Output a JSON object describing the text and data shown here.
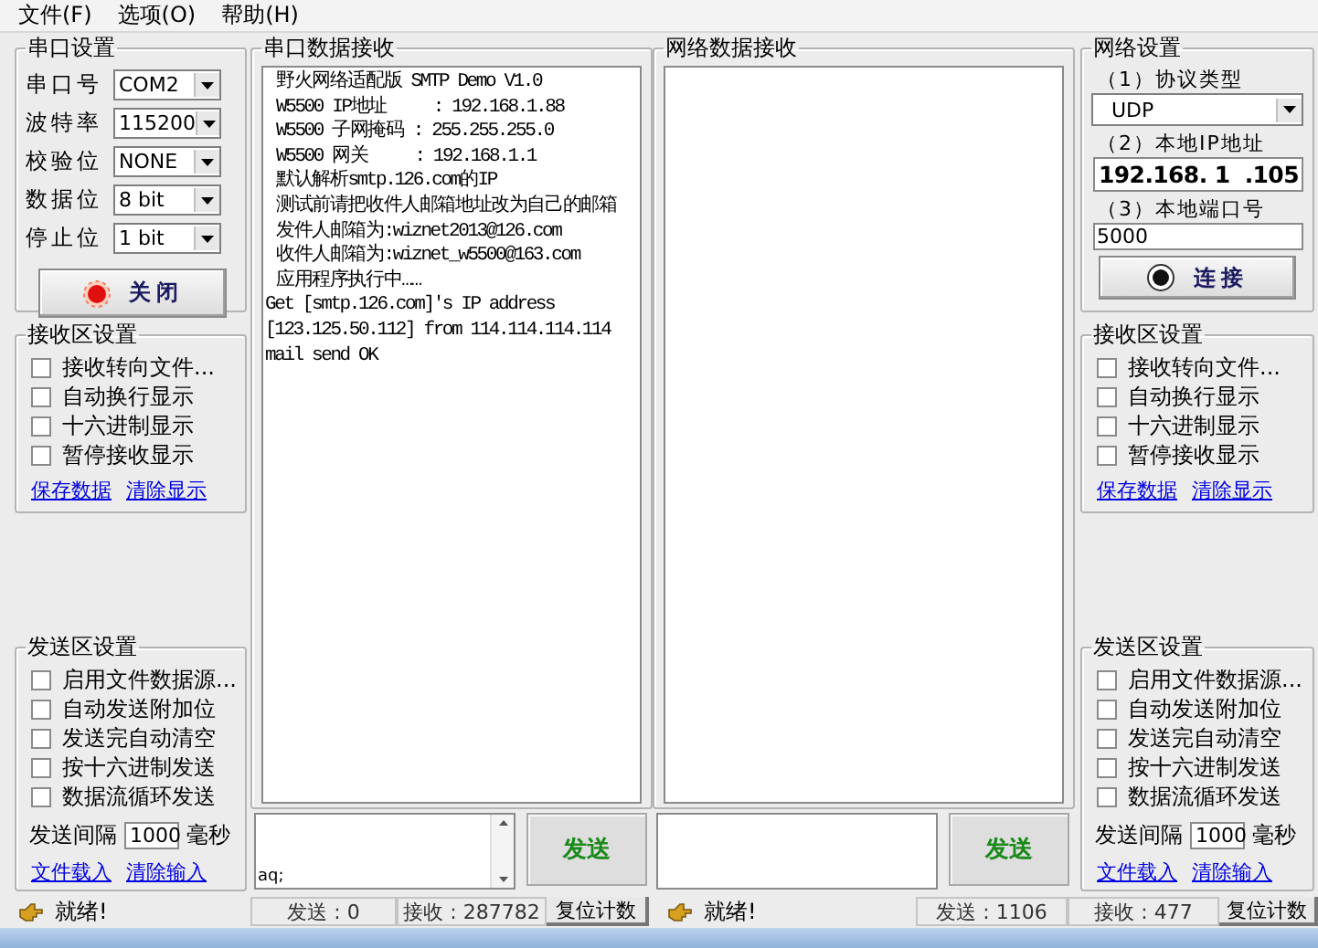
{
  "menu": [
    {
      "label": "文件(F)"
    },
    {
      "label": "选项(O)"
    },
    {
      "label": "帮助(H)"
    }
  ],
  "serial_settings": {
    "title": "串口设置",
    "fields": [
      {
        "label": "串口号",
        "value": "COM2"
      },
      {
        "label": "波特率",
        "value": "115200"
      },
      {
        "label": "校验位",
        "value": "NONE"
      },
      {
        "label": "数据位",
        "value": "8 bit"
      },
      {
        "label": "停止位",
        "value": "1 bit"
      }
    ],
    "button": {
      "label": "关闭",
      "open": true
    }
  },
  "serial_receive_settings": {
    "title": "接收区设置",
    "options": [
      {
        "label": "接收转向文件...",
        "checked": false
      },
      {
        "label": "自动换行显示",
        "checked": false
      },
      {
        "label": "十六进制显示",
        "checked": false
      },
      {
        "label": "暂停接收显示",
        "checked": false
      }
    ],
    "links": [
      "保存数据",
      "清除显示"
    ]
  },
  "serial_send_settings": {
    "title": "发送区设置",
    "options": [
      {
        "label": "启用文件数据源...",
        "checked": false
      },
      {
        "label": "自动发送附加位",
        "checked": false
      },
      {
        "label": "发送完自动清空",
        "checked": false
      },
      {
        "label": "按十六进制发送",
        "checked": false
      },
      {
        "label": "数据流循环发送",
        "checked": false
      }
    ],
    "interval": {
      "label": "发送间隔",
      "value": "1000",
      "unit": "毫秒"
    },
    "links": [
      "文件载入",
      "清除输入"
    ]
  },
  "serial_receive": {
    "title": "串口数据接收",
    "lines": [
      {
        "text": "野火网络适配版 SMTP Demo V1.0",
        "indent": true
      },
      {
        "text": "W5500 IP地址     : 192.168.1.88",
        "indent": true
      },
      {
        "text": "W5500 子网掩码 : 255.255.255.0",
        "indent": true
      },
      {
        "text": "W5500 网关     : 192.168.1.1",
        "indent": true
      },
      {
        "text": "默认解析smtp.126.com的IP",
        "indent": true
      },
      {
        "text": "测试前请把收件人邮箱地址改为自己的邮箱",
        "indent": true
      },
      {
        "text": "发件人邮箱为:wiznet2013@126.com",
        "indent": true
      },
      {
        "text": "收件人邮箱为:wiznet_w5500@163.com",
        "indent": true
      },
      {
        "text": "应用程序执行中……",
        "indent": true
      },
      {
        "text": "Get [smtp.126.com]'s IP address",
        "indent": false
      },
      {
        "text": "[123.125.50.112] from 114.114.114.114",
        "indent": false
      },
      {
        "text": "mail send OK",
        "indent": false
      }
    ]
  },
  "network_receive": {
    "title": "网络数据接收"
  },
  "network_settings": {
    "title": "网络设置",
    "protocol_label": "（1）协议类型",
    "protocol": "UDP",
    "ip_label": "（2）本地IP地址",
    "ip": "192.168. 1  .105",
    "port_label": "（3）本地端口号",
    "port": "5000",
    "button": {
      "label": "连接",
      "open": false
    }
  },
  "network_receive_settings": {
    "title": "接收区设置",
    "options": [
      {
        "label": "接收转向文件...",
        "checked": false
      },
      {
        "label": "自动换行显示",
        "checked": false
      },
      {
        "label": "十六进制显示",
        "checked": false
      },
      {
        "label": "暂停接收显示",
        "checked": false
      }
    ],
    "links": [
      "保存数据",
      "清除显示"
    ]
  },
  "network_send_settings": {
    "title": "发送区设置",
    "options": [
      {
        "label": "启用文件数据源...",
        "checked": false
      },
      {
        "label": "自动发送附加位",
        "checked": false
      },
      {
        "label": "发送完自动清空",
        "checked": false
      },
      {
        "label": "按十六进制发送",
        "checked": false
      },
      {
        "label": "数据流循环发送",
        "checked": false
      }
    ],
    "interval": {
      "label": "发送间隔",
      "value": "1000",
      "unit": "毫秒"
    },
    "links": [
      "文件载入",
      "清除输入"
    ]
  },
  "serial_send": {
    "value": "aq;",
    "button": "发送"
  },
  "network_send": {
    "button": "发送"
  },
  "serial_status": {
    "message": "就绪!",
    "sent": "发送 : 0",
    "received": "接收 : 287782",
    "reset": "复位计数"
  },
  "network_status": {
    "message": "就绪!",
    "sent": "发送 : 1106",
    "received": "接收 : 477",
    "reset": "复位计数"
  }
}
